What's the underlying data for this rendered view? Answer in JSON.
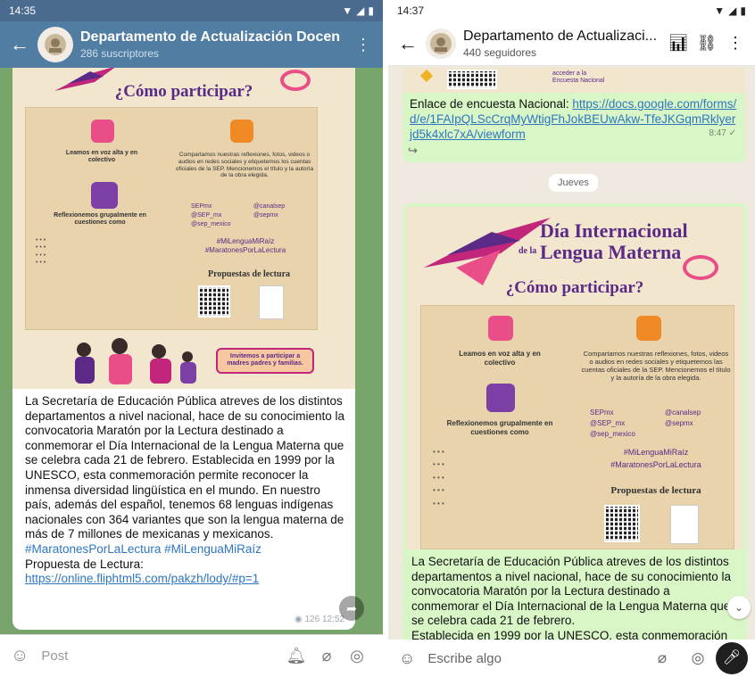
{
  "left": {
    "status_time": "14:35",
    "header": {
      "title": "Departamento de Actualización Docen",
      "subtitle": "286 suscriptores"
    },
    "poster": {
      "heading": "¿Cómo participar?",
      "col1_a": "Leamos en voz alta y en colectivo",
      "col1_b": "Reflexionemos grupalmente en cuestiones como",
      "col2_a": "Compartamos nuestras reflexiones, fotos, videos o audios en redes sociales y etiquetemos los cuentas oficiales de la SEP. Mencionemos el título y la autoría de la obra elegida.",
      "social_1": "SEPmx",
      "social_2": "@canalsep",
      "social_3": "@SEP_mx",
      "social_4": "@sepmx",
      "social_5": "@sep_mexico",
      "hashtags": "#MiLenguaMiRaíz #MaratonesPorLaLectura",
      "propuestas": "Propuestas de lectura",
      "invite": "Invitemos a participar a madres padres y familias."
    },
    "message": {
      "body": "La Secretaría de Educación Pública atreves de los distintos departamentos a nivel nacional, hace de su conocimiento la convocatoria Maratón por la Lectura destinado a conmemorar el Día Internacional de la Lengua Materna que se celebra cada 21 de febrero. Establecida en 1999 por la UNESCO, esta conmemoración permite reconocer la inmensa diversidad lingüística en el mundo. En nuestro país, además del español, tenemos 68 lenguas indígenas nacionales con 364 variantes que son la lengua materna de más de 7 millones de mexicanas y mexicanos.",
      "hashtags": "#MaratonesPorLaLectura #MiLenguaMiRaíz",
      "propuesta_label": "Propuesta de Lectura:",
      "link": "https://online.fliphtml5.com/pakzh/lody/#p=1",
      "views": "126",
      "time": "12:52"
    },
    "input_placeholder": "Post"
  },
  "right": {
    "status_time": "14:37",
    "header": {
      "title": "Departamento de Actualizaci...",
      "subtitle": "440 seguidores"
    },
    "first_msg": {
      "strip_text": "acceder a la Encuesta Nacional",
      "label": "Enlace de encuesta Nacional: ",
      "link": "https://docs.google.com/forms/d/e/1FAIpQLScCrqMyWtigFhJokBEUwAkw-TfeJKGqmRklyerjd5k4xlc7xA/viewform",
      "time": "8:47 ✓"
    },
    "day_label": "Jueves",
    "poster": {
      "title_1": "Día Internacional",
      "title_2": "de la",
      "title_3": "Lengua Materna",
      "heading": "¿Cómo participar?",
      "col1_a": "Leamos en voz alta y en colectivo",
      "col1_b": "Reflexionemos grupalmente en cuestiones como",
      "col2_a": "Compartamos nuestras reflexiones, fotos, videos o audios en redes sociales y etiquetemos las cuentas oficiales de la SEP. Mencionemos el título y la autoría de la obra elegida.",
      "social_1": "SEPmx",
      "social_2": "@canalsep",
      "social_3": "@SEP_mx",
      "social_4": "@sepmx",
      "social_5": "@sep_mexico",
      "hashtag_1": "#MiLenguaMiRaíz",
      "hashtag_2": "#MaratonesPorLaLectura",
      "propuestas": "Propuestas de lectura"
    },
    "message": {
      "body": "La Secretaría de Educación Pública atreves de los distintos departamentos a nivel nacional, hace de su conocimiento la convocatoria Maratón por la Lectura destinado a conmemorar el Día Internacional de la Lengua Materna que se celebra cada 21 de febrero.",
      "body_cut": "Establecida en 1999 por la UNESCO, esta conmemoración"
    },
    "input_placeholder": "Escribe algo"
  }
}
